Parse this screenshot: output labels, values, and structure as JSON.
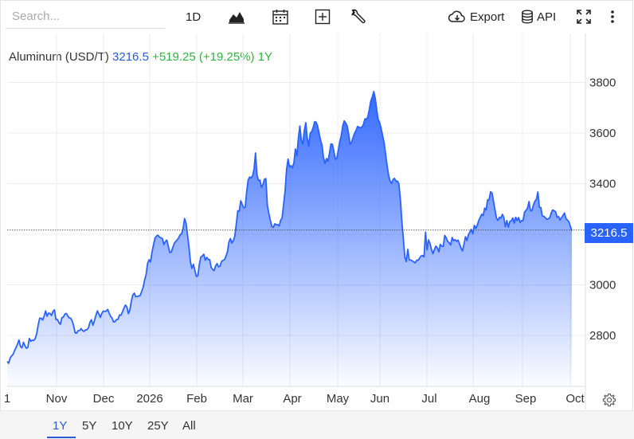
{
  "toolbar": {
    "search_placeholder": "Search...",
    "interval_label": "1D",
    "export_label": "Export",
    "api_label": "API",
    "icons": [
      "chart-type-icon",
      "calendar-icon",
      "add-indicator-icon",
      "wrench-icon",
      "cloud-download-icon",
      "database-icon",
      "fullscreen-icon",
      "more-vertical-icon"
    ]
  },
  "quote": {
    "symbol": "Aluminum (USD/T)",
    "price": "3216.5",
    "change": "+519.25 (+19.25%) 1Y",
    "colors": {
      "price": "#2a5bd7",
      "change": "#2fb344"
    }
  },
  "price_tag": "3216.5",
  "range_buttons": [
    {
      "label": "1Y",
      "active": true
    },
    {
      "label": "5Y",
      "active": false
    },
    {
      "label": "10Y",
      "active": false
    },
    {
      "label": "25Y",
      "active": false
    },
    {
      "label": "All",
      "active": false
    }
  ],
  "chart_data": {
    "type": "area",
    "y_ticks": [
      2800,
      3000,
      3200,
      3400,
      3600,
      3800
    ],
    "y_tick_labels": [
      "2800",
      "3000",
      "3400",
      "3600",
      "3800"
    ],
    "ylim": [
      2620,
      3880
    ],
    "x_tick_labels": [
      "1",
      "Nov",
      "Dec",
      "2026",
      "Feb",
      "Mar",
      "Apr",
      "May",
      "Jun",
      "Jul",
      "Aug",
      "Sep",
      "Oct"
    ],
    "last_value": 3216.5,
    "colors": {
      "line": "#2962ff",
      "fill_top": "#2962ff",
      "fill_bottom": "#ffffff"
    },
    "grid": true,
    "series": [
      {
        "values": [
          2697,
          2690,
          2710,
          2719,
          2725,
          2740,
          2752,
          2766,
          2782,
          2756,
          2751,
          2773,
          2759,
          2749,
          2753,
          2788,
          2777,
          2781,
          2780,
          2788,
          2808,
          2842,
          2868,
          2868,
          2861,
          2876,
          2897,
          2876,
          2888,
          2887,
          2879,
          2895,
          2901,
          2863,
          2863,
          2851,
          2844,
          2870,
          2872,
          2884,
          2887,
          2877,
          2869,
          2868,
          2857,
          2837,
          2810,
          2809,
          2819,
          2819,
          2827,
          2819,
          2816,
          2822,
          2823,
          2830,
          2852,
          2862,
          2840,
          2858,
          2878,
          2897,
          2885,
          2871,
          2887,
          2896,
          2895,
          2896,
          2903,
          2888,
          2875,
          2868,
          2853,
          2855,
          2863,
          2864,
          2881,
          2880,
          2893,
          2908,
          2920,
          2912,
          2886,
          2901,
          2935,
          2960,
          2967,
          2953,
          2954,
          2956,
          2958,
          2974,
          2991,
          3019,
          3041,
          3085,
          3099,
          3091,
          3130,
          3158,
          3185,
          3193,
          3196,
          3189,
          3186,
          3183,
          3159,
          3171,
          3177,
          3152,
          3128,
          3129,
          3147,
          3163,
          3172,
          3177,
          3186,
          3198,
          3202,
          3223,
          3262,
          3244,
          3197,
          3150,
          3089,
          3065,
          3081,
          3056,
          3033,
          3036,
          3081,
          3110,
          3114,
          3121,
          3097,
          3109,
          3100,
          3100,
          3069,
          3061,
          3056,
          3075,
          3084,
          3071,
          3074,
          3092,
          3097,
          3099,
          3113,
          3131,
          3169,
          3183,
          3165,
          3175,
          3193,
          3241,
          3293,
          3291,
          3332,
          3318,
          3305,
          3306,
          3368,
          3414,
          3426,
          3423,
          3431,
          3457,
          3521,
          3435,
          3412,
          3414,
          3386,
          3396,
          3417,
          3420,
          3315,
          3283,
          3256,
          3231,
          3227,
          3241,
          3238,
          3238,
          3233,
          3255,
          3265,
          3318,
          3372,
          3456,
          3497,
          3466,
          3471,
          3463,
          3484,
          3537,
          3511,
          3581,
          3628,
          3571,
          3557,
          3609,
          3641,
          3580,
          3547,
          3600,
          3606,
          3622,
          3645,
          3643,
          3628,
          3599,
          3572,
          3552,
          3502,
          3480,
          3499,
          3489,
          3520,
          3557,
          3556,
          3528,
          3496,
          3501,
          3533,
          3567,
          3590,
          3628,
          3648,
          3640,
          3628,
          3596,
          3556,
          3564,
          3583,
          3599,
          3610,
          3626,
          3623,
          3621,
          3624,
          3634,
          3656,
          3654,
          3665,
          3694,
          3727,
          3743,
          3764,
          3737,
          3691,
          3654,
          3641,
          3618,
          3589,
          3561,
          3517,
          3472,
          3434,
          3411,
          3401,
          3416,
          3421,
          3409,
          3410,
          3398,
          3339,
          3250,
          3182,
          3110,
          3092,
          3140,
          3098,
          3098,
          3095,
          3091,
          3087,
          3097,
          3097,
          3106,
          3114,
          3116,
          3111,
          3208,
          3138,
          3178,
          3164,
          3140,
          3123,
          3139,
          3153,
          3146,
          3130,
          3160,
          3153,
          3152,
          3195,
          3186,
          3172,
          3166,
          3158,
          3187,
          3174,
          3179,
          3172,
          3177,
          3162,
          3145,
          3134,
          3160,
          3190,
          3175,
          3198,
          3209,
          3219,
          3202,
          3235,
          3223,
          3236,
          3254,
          3267,
          3279,
          3274,
          3303,
          3296,
          3336,
          3336,
          3368,
          3363,
          3330,
          3296,
          3264,
          3255,
          3267,
          3264,
          3279,
          3265,
          3230,
          3254,
          3228,
          3250,
          3253,
          3264,
          3244,
          3267,
          3254,
          3266,
          3247,
          3254,
          3254,
          3288,
          3294,
          3303,
          3329,
          3293,
          3294,
          3316,
          3331,
          3338,
          3367,
          3307,
          3306,
          3272,
          3271,
          3266,
          3259,
          3261,
          3265,
          3284,
          3296,
          3293,
          3289,
          3267,
          3270,
          3256,
          3266,
          3274,
          3284,
          3262,
          3256,
          3249,
          3231,
          3214
        ]
      }
    ]
  }
}
